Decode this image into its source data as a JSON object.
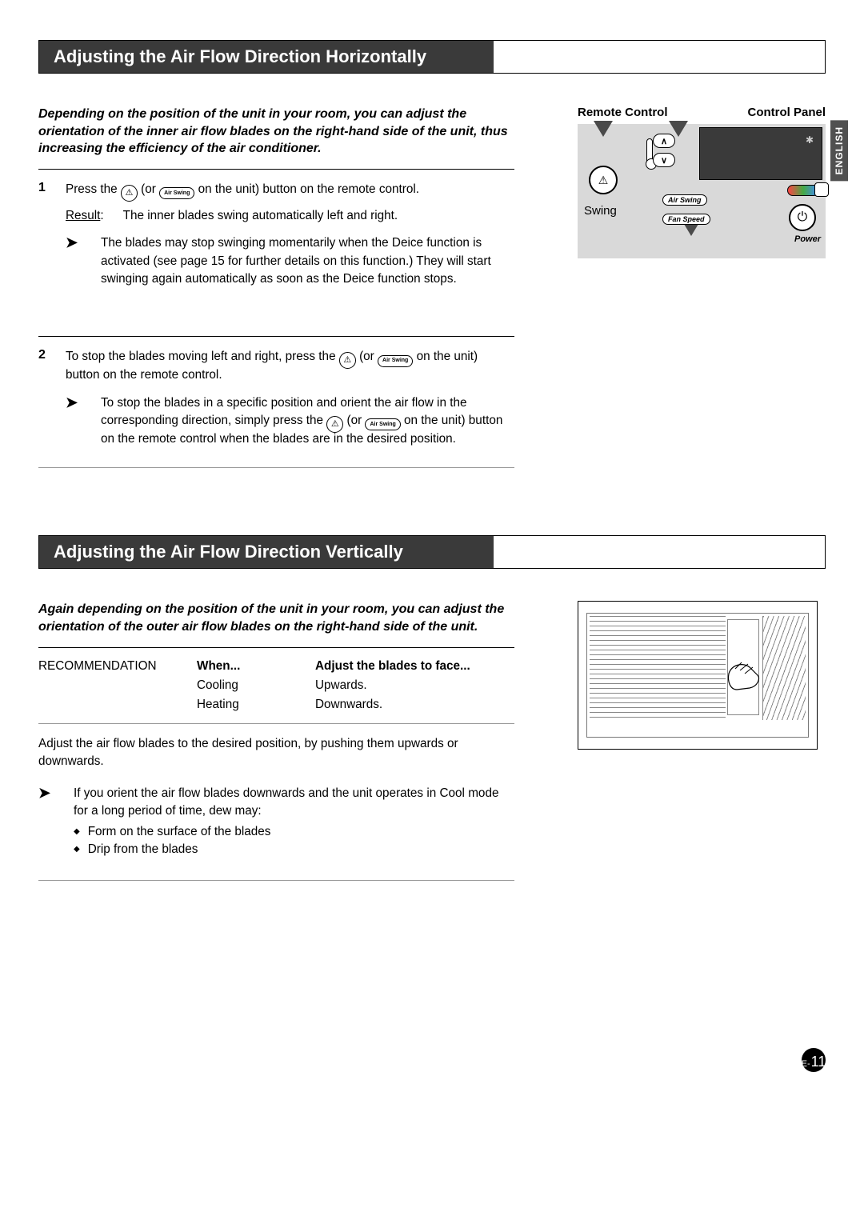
{
  "lang_tab": "ENGLISH",
  "titles": {
    "h1": "Adjusting the Air Flow Direction Horizontally",
    "h2": "Adjusting the Air Flow Direction Vertically"
  },
  "horiz": {
    "intro": "Depending on the position of the unit in your room, you can adjust the orientation of the inner air flow blades on the right-hand side of the unit, thus increasing the efficiency of the air conditioner.",
    "step1": {
      "num": "1",
      "line_a": "Press the ",
      "line_b": " (or ",
      "line_c": " on the unit) button on the remote control.",
      "result_label": "Result",
      "result_text": "The inner blades swing automatically left and right.",
      "note": "The blades may stop swinging momentarily when the Deice function is activated (see page 15 for further details on this function.) They will start swinging again automatically as soon as the Deice function stops."
    },
    "step2": {
      "num": "2",
      "line_a": "To stop the blades moving left and right, press the ",
      "line_b": " (or ",
      "line_c": " on the unit) button on the remote control.",
      "note_a": "To stop the blades in a specific position and orient the air flow in the corresponding direction, simply press the ",
      "note_b": " (or ",
      "note_c": " on the unit) button on the remote control when the blades are in the desired position."
    }
  },
  "diagram": {
    "remote_label": "Remote Control",
    "control_label": "Control Panel",
    "swing_label": "Swing",
    "air_swing_btn": "Air Swing",
    "fan_speed_btn": "Fan Speed",
    "power_label": "Power",
    "air_swing_oval": "Air Swing"
  },
  "vert": {
    "intro": "Again depending on the position of the unit in your room, you can adjust the orientation of the outer air flow blades on the right-hand side of the unit.",
    "rec_label": "RECOMMENDATION",
    "col_when": "When...",
    "col_adjust": "Adjust the blades to face...",
    "rows": [
      {
        "when": "Cooling",
        "adjust": "Upwards."
      },
      {
        "when": "Heating",
        "adjust": "Downwards."
      }
    ],
    "adjust_text": "Adjust the air flow blades to the desired position, by pushing them upwards or downwards.",
    "note_intro": "If you orient the air flow blades downwards and the unit operates in Cool mode for a long period of time, dew may:",
    "bullets": [
      "Form on the surface of the blades",
      "Drip from the blades"
    ]
  },
  "page_number": {
    "prefix": "E-",
    "num": "11"
  },
  "icons": {
    "swing_glyph": "⚠",
    "power_glyph": "⏻",
    "arrow_note": "➤"
  }
}
